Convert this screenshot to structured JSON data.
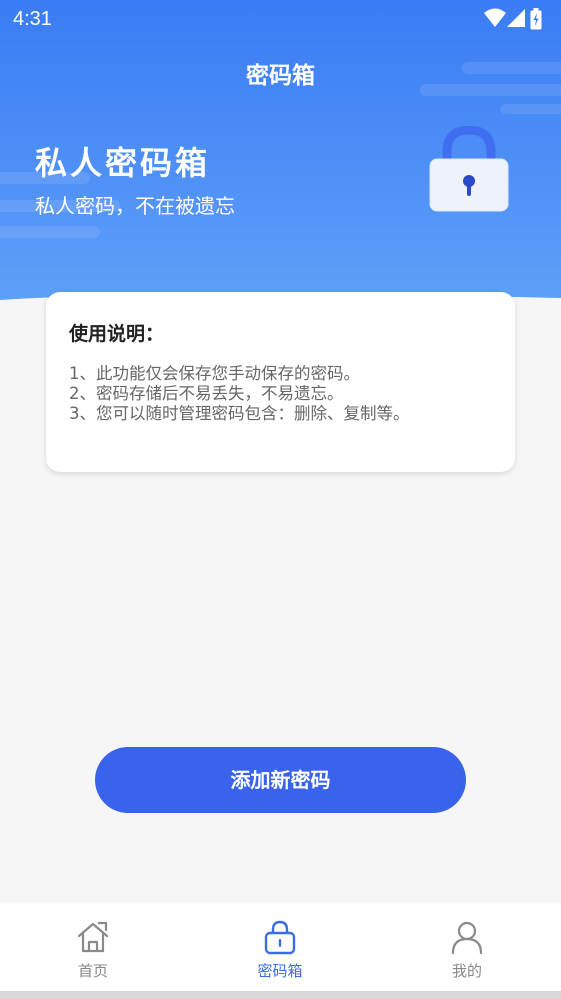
{
  "status_bar": {
    "time": "4:31",
    "icons": [
      "wifi-icon",
      "signal-icon",
      "battery-icon"
    ]
  },
  "header": {
    "title": "密码箱"
  },
  "hero": {
    "title": "私人密码箱",
    "subtitle": "私人密码，不在被遗忘",
    "illustration": "lock-icon"
  },
  "instructions": {
    "title": "使用说明：",
    "lines": [
      "1、此功能仅会保存您手动保存的密码。",
      "2、密码存储后不易丢失，不易遗忘。",
      "3、您可以随时管理密码包含：删除、复制等。"
    ]
  },
  "actions": {
    "add_label": "添加新密码"
  },
  "bottom_nav": {
    "items": [
      {
        "label": "首页",
        "icon": "home-icon",
        "active": false
      },
      {
        "label": "密码箱",
        "icon": "lock-icon",
        "active": true
      },
      {
        "label": "我的",
        "icon": "user-icon",
        "active": false
      }
    ]
  },
  "colors": {
    "primary": "#3a63ec",
    "hero_top": "#3a7cf4",
    "hero_bottom": "#5b9cf8",
    "nav_active": "#3a6de0",
    "nav_inactive": "#888888",
    "page_bg": "#f6f6f6"
  }
}
